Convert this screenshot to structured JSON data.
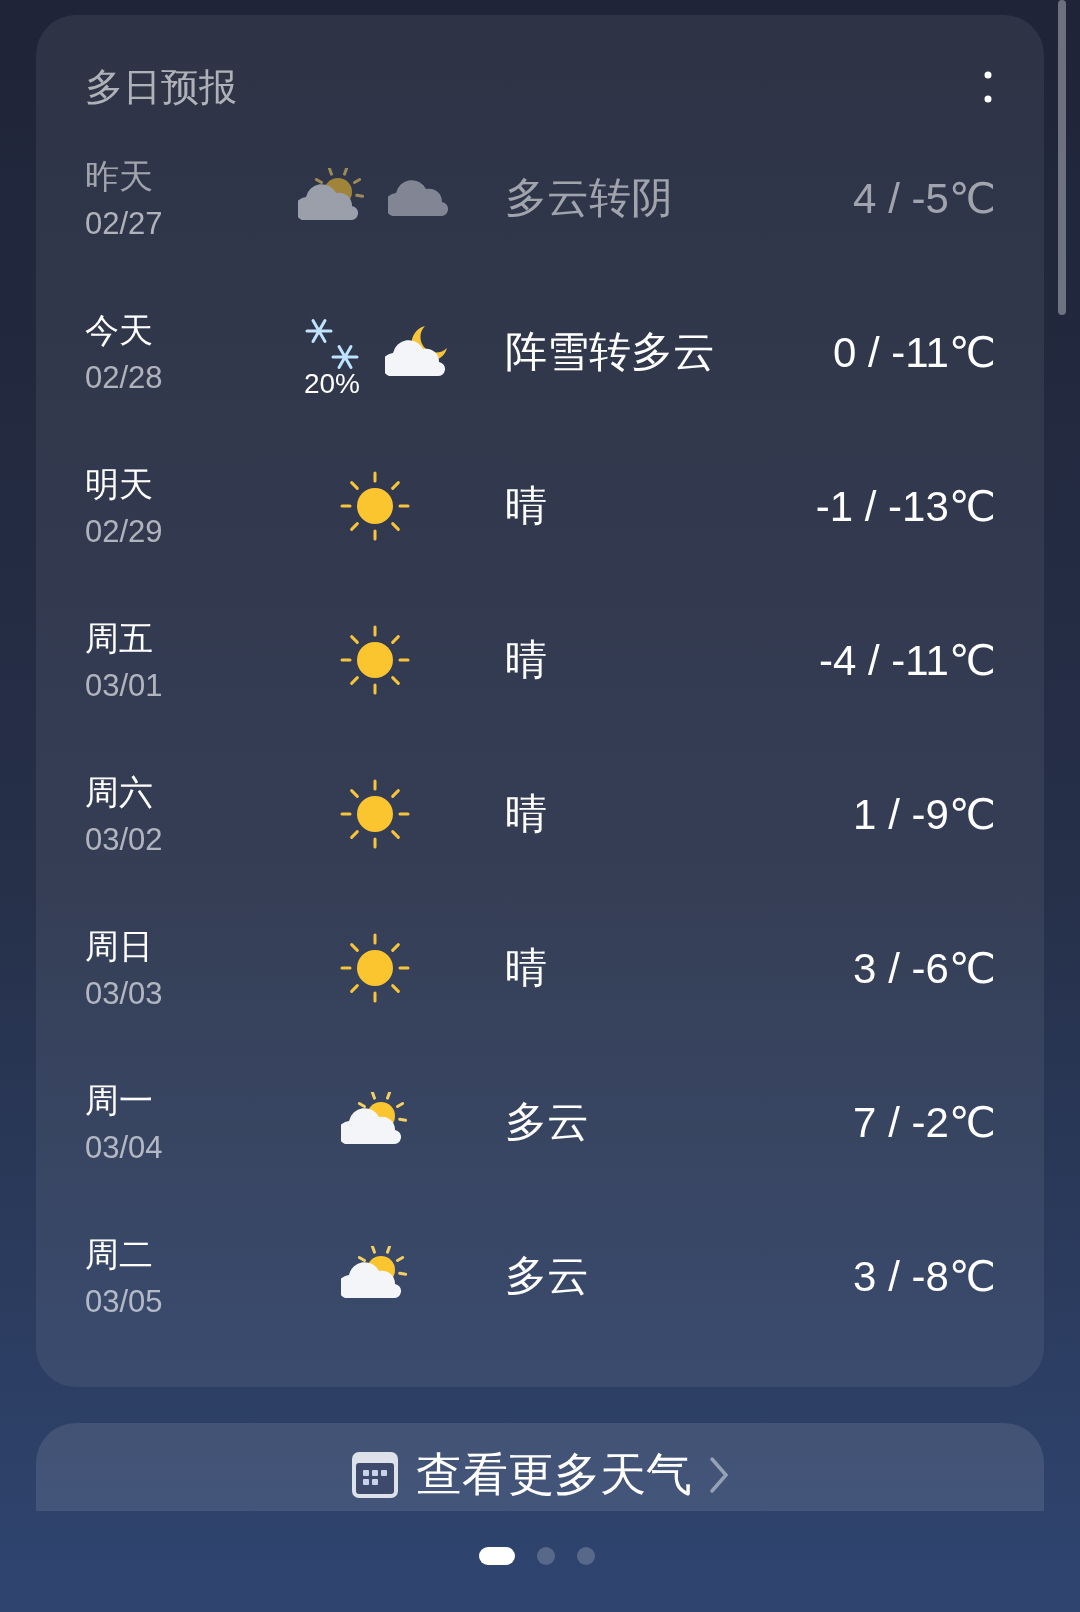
{
  "header": {
    "title": "多日预报"
  },
  "days": [
    {
      "day": "昨天",
      "date": "02/27",
      "past": true,
      "icons": [
        {
          "kind": "partly_cloudy"
        },
        {
          "kind": "cloudy"
        }
      ],
      "condition": "多云转阴",
      "temps": "4 / -5℃"
    },
    {
      "day": "今天",
      "date": "02/28",
      "past": false,
      "icons": [
        {
          "kind": "snow",
          "precip": "20%"
        },
        {
          "kind": "moon_cloud"
        }
      ],
      "condition": "阵雪转多云",
      "temps": "0 / -11℃"
    },
    {
      "day": "明天",
      "date": "02/29",
      "past": false,
      "icons": [
        {
          "kind": "sunny"
        }
      ],
      "condition": "晴",
      "temps": "-1 / -13℃"
    },
    {
      "day": "周五",
      "date": "03/01",
      "past": false,
      "icons": [
        {
          "kind": "sunny"
        }
      ],
      "condition": "晴",
      "temps": "-4 / -11℃"
    },
    {
      "day": "周六",
      "date": "03/02",
      "past": false,
      "icons": [
        {
          "kind": "sunny"
        }
      ],
      "condition": "晴",
      "temps": "1 / -9℃"
    },
    {
      "day": "周日",
      "date": "03/03",
      "past": false,
      "icons": [
        {
          "kind": "sunny"
        }
      ],
      "condition": "晴",
      "temps": "3 / -6℃"
    },
    {
      "day": "周一",
      "date": "03/04",
      "past": false,
      "icons": [
        {
          "kind": "partly_cloudy"
        }
      ],
      "condition": "多云",
      "temps": "7 / -2℃"
    },
    {
      "day": "周二",
      "date": "03/05",
      "past": false,
      "icons": [
        {
          "kind": "partly_cloudy"
        }
      ],
      "condition": "多云",
      "temps": "3 / -8℃"
    }
  ],
  "more_button": {
    "label": "查看更多天气"
  },
  "pages": [
    {
      "selected": true
    },
    {
      "selected": false
    },
    {
      "selected": false
    }
  ]
}
